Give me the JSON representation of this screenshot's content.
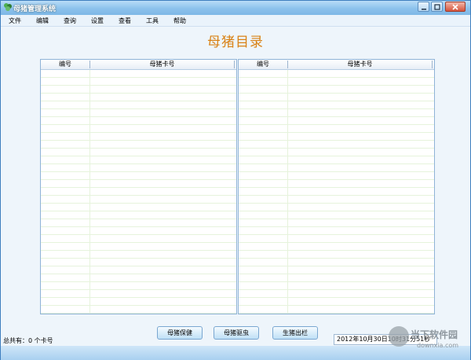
{
  "window": {
    "title": "母猪管理系统"
  },
  "menu": [
    "文件",
    "编辑",
    "查询",
    "设置",
    "查看",
    "工具",
    "帮助"
  ],
  "page_title": "母猪目录",
  "tables": [
    {
      "columns": [
        "编号",
        "母猪卡号"
      ]
    },
    {
      "columns": [
        "编号",
        "母猪卡号"
      ]
    }
  ],
  "buttons": [
    "母猪保健",
    "母猪驱虫",
    "生猪出栏"
  ],
  "status": {
    "left": "总共有：0 个卡号",
    "right": "2012年10月30日10时31分51秒"
  },
  "watermark": {
    "cn": "当下软件园",
    "en": "downxia.com"
  },
  "colors": {
    "title_orange": "#d98215",
    "accent_blue": "#3f7fbf"
  }
}
